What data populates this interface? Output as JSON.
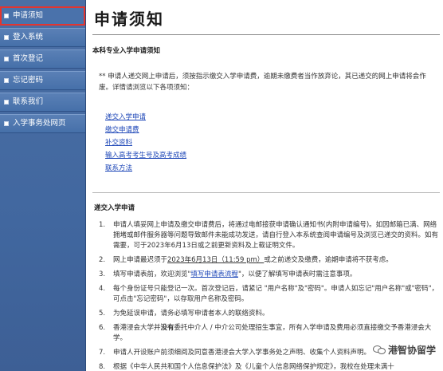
{
  "sidebar": {
    "items": [
      {
        "label": "申请须知"
      },
      {
        "label": "登入系统"
      },
      {
        "label": "首次登记"
      },
      {
        "label": "忘记密码"
      },
      {
        "label": "联系我们"
      },
      {
        "label": "入学事务处网页"
      }
    ]
  },
  "main": {
    "title": "申请须知",
    "heading1": "本科专业入学申请须知",
    "notice": "** 申请人递交网上申请后，须按指示缴交入学申请费，逾期未缴费者当作放弃论，其已递交的网上申请将会作废。详情请浏览以下各项须知：",
    "links": [
      "递交入学申请",
      "缴交申请费",
      "补交资料",
      "输入高考考生号及高考成绩",
      "联系方法"
    ],
    "heading2": "递交入学申请",
    "list": [
      {
        "num": "1.",
        "text": "申请人填妥网上申请及缴交申请费后，将通过电邮接获申请确认通知书(内附申请编号)。如因邮箱已满、网络拥堵或邮件服务器等问题导致邮件未能成功发送，请自行登入本系统查阅申请编号及浏览已递交的资料。如有需要，可于2023年6月13日或之前更新资料及上载证明文件。"
      },
      {
        "num": "2.",
        "pre": "网上申请最迟须于",
        "underline": "2023年6月13日（11:59 pm）",
        "post": "或之前递交及缴费，逾期申请将不获考虑。"
      },
      {
        "num": "3.",
        "pre": "填写申请表前，欢迎浏览\"",
        "link": "填写申请表流程",
        "post": "\"，以便了解填写申请表时需注意事项。"
      },
      {
        "num": "4.",
        "text": "每个身份证号只能登记一次。首次登记后，请紧记 \"用户名称\"及\"密码\"。申请人如忘记\"用户名称\"或\"密码\"，可点击\"忘记密码\"，以存取用户名称及密码。"
      },
      {
        "num": "5.",
        "text": "为免延误申请，请务必填写申请者本人的联络资料。"
      },
      {
        "num": "6.",
        "pre": "香港浸会大学并",
        "bold": "没有",
        "post": "委托中介人 / 中介公司处理招生事宜，所有入学申请及费用必须直接缴交予香港浸会大学。"
      },
      {
        "num": "7.",
        "text": "申请人开设账户前须细阅及同意香港浸会大学入学事务处之声明、收集个人资料声明。"
      },
      {
        "num": "8.",
        "text": "根据《中华人民共和国个人信息保护法》及《儿童个人信息网络保护规定》，我校在处理未满十"
      }
    ]
  },
  "watermark": {
    "text": "港智协留学",
    "icon": "wechat-icon"
  }
}
